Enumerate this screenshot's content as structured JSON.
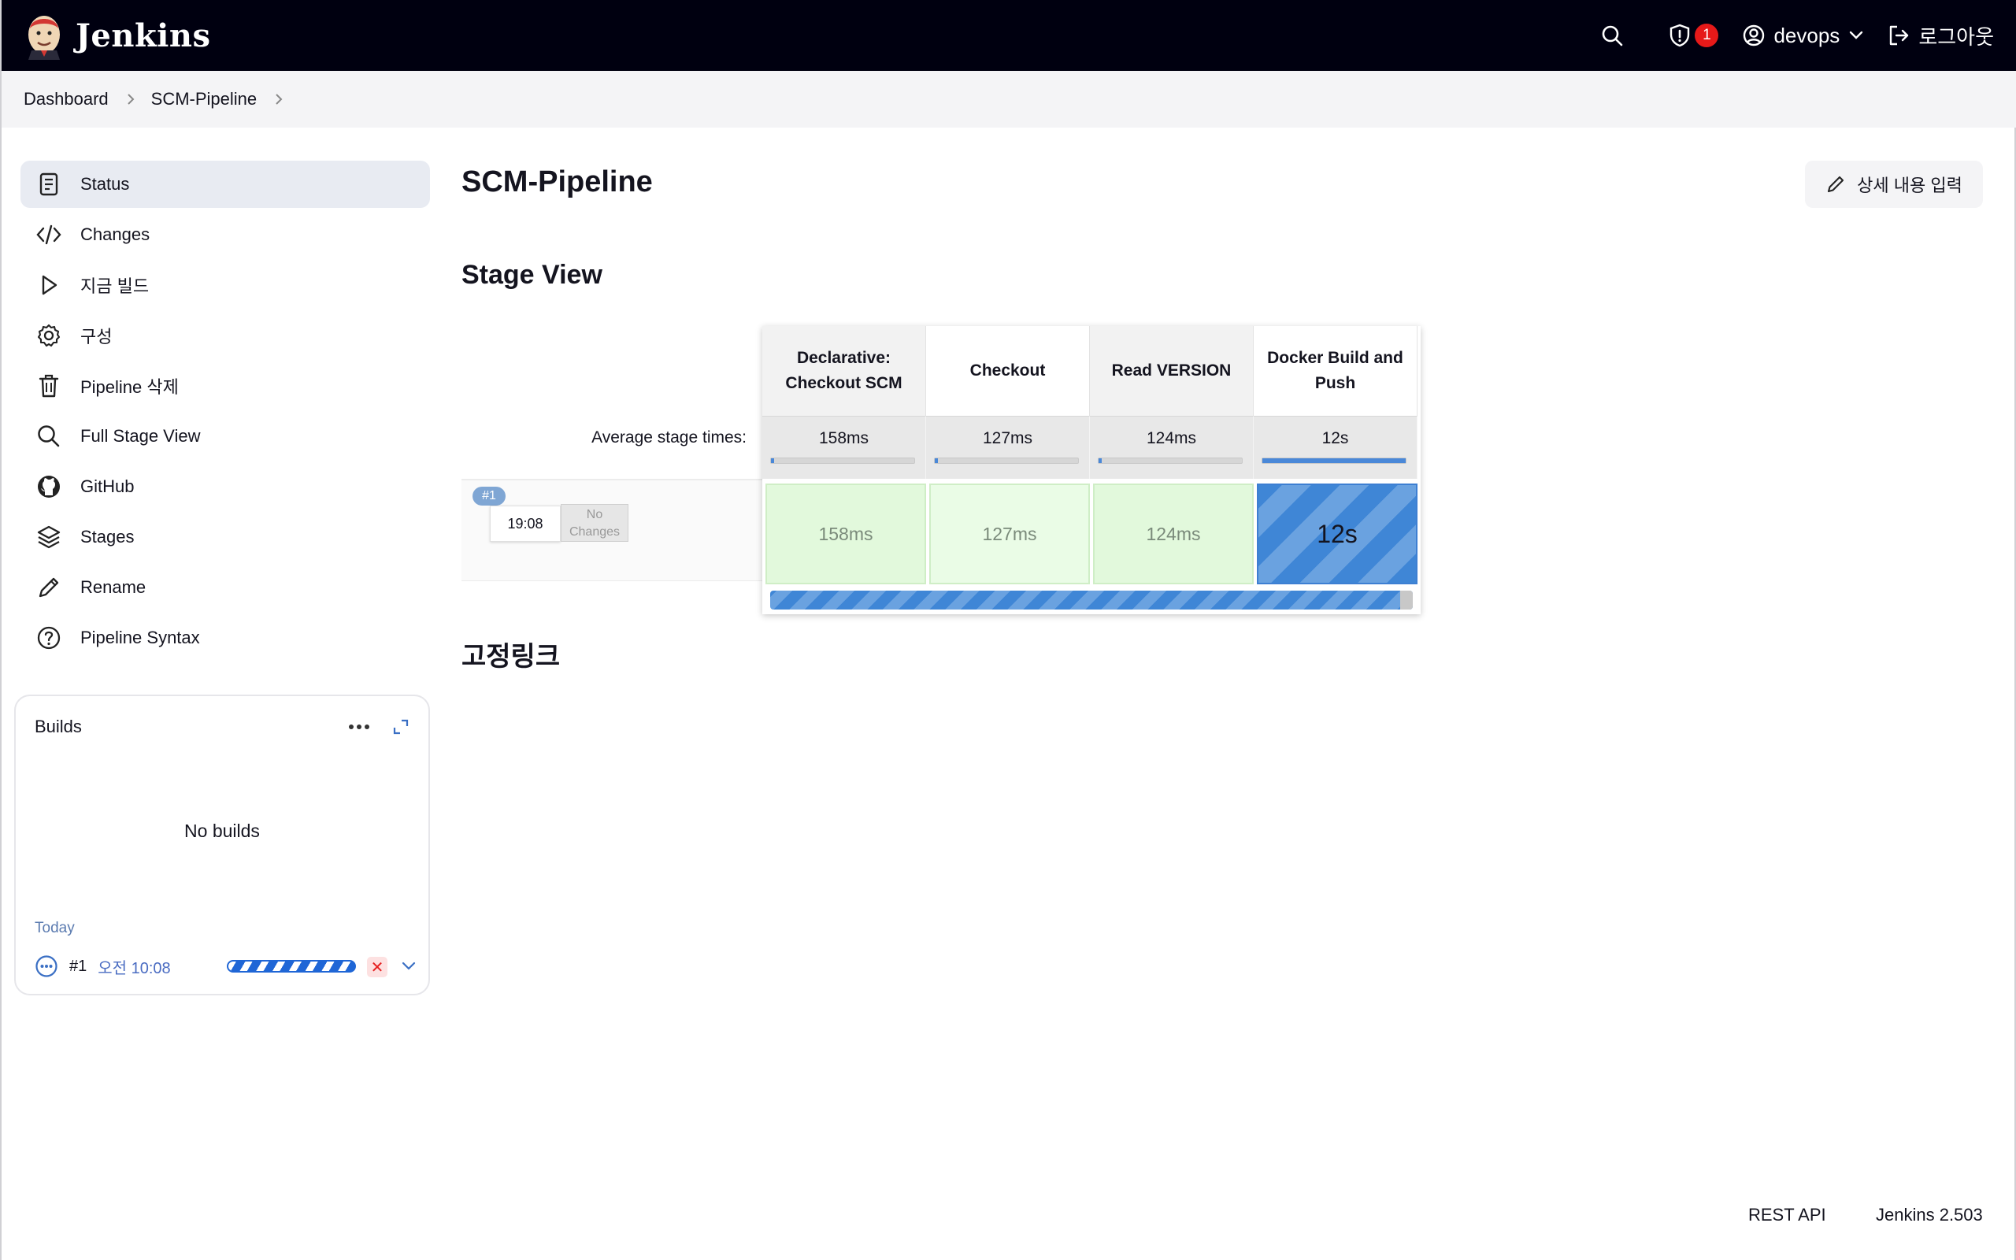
{
  "header": {
    "brand": "Jenkins",
    "security_count": "1",
    "user": "devops",
    "logout_label": "로그아웃"
  },
  "breadcrumb": {
    "items": [
      "Dashboard",
      "SCM-Pipeline"
    ]
  },
  "sidebar": {
    "items": [
      {
        "label": "Status",
        "icon": "document-icon",
        "active": true
      },
      {
        "label": "Changes",
        "icon": "code-icon"
      },
      {
        "label": "지금 빌드",
        "icon": "play-icon"
      },
      {
        "label": "구성",
        "icon": "gear-icon"
      },
      {
        "label": "Pipeline 삭제",
        "icon": "trash-icon"
      },
      {
        "label": "Full Stage View",
        "icon": "search-icon"
      },
      {
        "label": "GitHub",
        "icon": "github-icon"
      },
      {
        "label": "Stages",
        "icon": "layers-icon"
      },
      {
        "label": "Rename",
        "icon": "pencil-icon"
      },
      {
        "label": "Pipeline Syntax",
        "icon": "help-icon"
      }
    ]
  },
  "builds": {
    "title": "Builds",
    "empty_text": "No builds",
    "group_label": "Today",
    "row": {
      "number": "#1",
      "time": "오전 10:08",
      "cancel": "✕"
    }
  },
  "main": {
    "title": "SCM-Pipeline",
    "edit_button": "상세 내용 입력",
    "stage_view_title": "Stage View",
    "permalinks_title": "고정링크"
  },
  "stage_view": {
    "average_label": "Average stage times:",
    "stages": [
      {
        "name": "Declarative: Checkout SCM",
        "avg": "158ms",
        "avg_fraction": 0.02
      },
      {
        "name": "Checkout",
        "avg": "127ms",
        "avg_fraction": 0.02
      },
      {
        "name": "Read VERSION",
        "avg": "124ms",
        "avg_fraction": 0.02
      },
      {
        "name": "Docker Build and Push",
        "avg": "12s",
        "avg_fraction": 1.0
      }
    ],
    "run": {
      "badge": "#1",
      "time": "19:08",
      "changes": "No Changes",
      "durations": [
        "158ms",
        "127ms",
        "124ms",
        "12s"
      ],
      "statuses": [
        "success",
        "success",
        "success",
        "running"
      ],
      "progress_fraction": 0.98
    }
  },
  "colors": {
    "header_bg": "#000010",
    "success": "#e2f9dc",
    "running": "#3f86d6",
    "alert": "#e61919"
  },
  "footer": {
    "rest_api": "REST API",
    "version": "Jenkins 2.503"
  }
}
